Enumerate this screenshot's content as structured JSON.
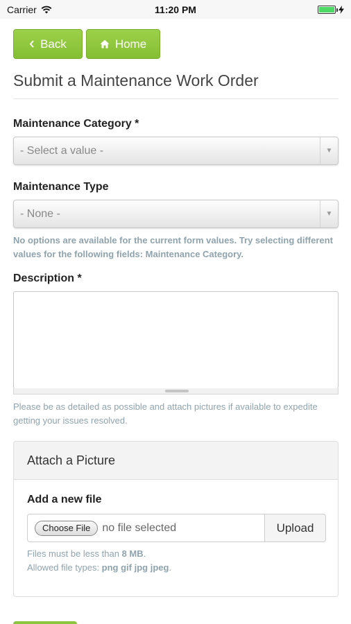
{
  "status_bar": {
    "carrier": "Carrier",
    "time": "11:20 PM"
  },
  "nav": {
    "back_label": "Back",
    "home_label": "Home"
  },
  "page_title": "Submit a Maintenance Work Order",
  "form": {
    "category": {
      "label": "Maintenance Category *",
      "value": "- Select a value -"
    },
    "type": {
      "label": "Maintenance Type",
      "value": "- None -",
      "help": "No options are available for the current form values. Try selecting different values for the following fields: Maintenance Category."
    },
    "description": {
      "label": "Description *",
      "value": "",
      "help": "Please be as detailed as possible and attach pictures if available to expedite getting your issues resolved."
    }
  },
  "attach": {
    "title": "Attach a Picture",
    "add_label": "Add a new file",
    "choose_label": "Choose File",
    "no_file_text": "no file selected",
    "upload_label": "Upload",
    "size_text_prefix": "Files must be less than ",
    "size_limit": "8 MB",
    "size_text_suffix": ".",
    "types_text_prefix": "Allowed file types: ",
    "types": "png gif jpg jpeg",
    "types_text_suffix": "."
  },
  "colors": {
    "accent_green": "#8cc63f",
    "help_text": "#8fa3ad"
  },
  "icons": {
    "back": "chevron-left-icon",
    "home": "home-icon",
    "wifi": "wifi-icon",
    "battery": "battery-icon",
    "select_arrow": "triangle-down-icon"
  }
}
